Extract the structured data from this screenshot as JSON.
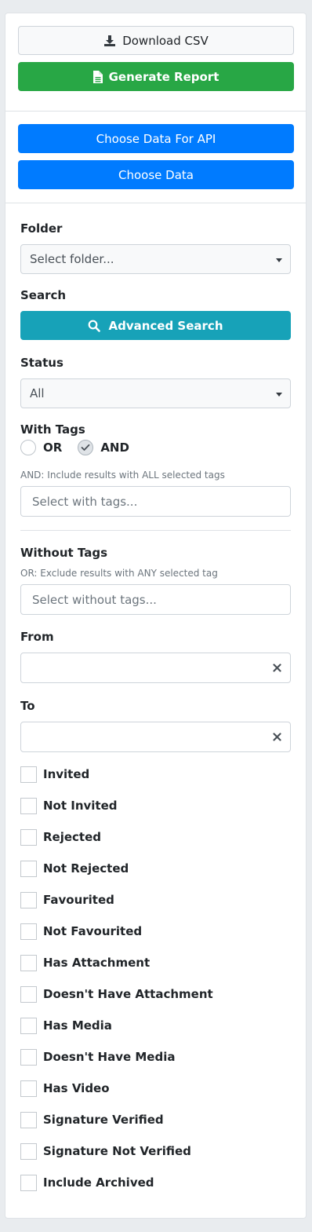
{
  "actions": {
    "download_csv": "Download CSV",
    "generate_report": "Generate Report",
    "choose_data_api": "Choose Data For API",
    "choose_data": "Choose Data"
  },
  "folder": {
    "label": "Folder",
    "value": "Select folder..."
  },
  "search": {
    "label": "Search",
    "advanced_label": "Advanced Search"
  },
  "status": {
    "label": "Status",
    "value": "All"
  },
  "with_tags": {
    "label": "With Tags",
    "mode_or": "OR",
    "mode_and": "AND",
    "selected_mode": "AND",
    "help": "AND: Include results with ALL selected tags",
    "placeholder": "Select with tags..."
  },
  "without_tags": {
    "label": "Without Tags",
    "help": "OR: Exclude results with ANY selected tag",
    "placeholder": "Select without tags..."
  },
  "dates": {
    "from_label": "From",
    "from_value": "",
    "to_label": "To",
    "to_value": ""
  },
  "filters": [
    {
      "label": "Invited",
      "checked": false
    },
    {
      "label": "Not Invited",
      "checked": false
    },
    {
      "label": "Rejected",
      "checked": false
    },
    {
      "label": "Not Rejected",
      "checked": false
    },
    {
      "label": "Favourited",
      "checked": false
    },
    {
      "label": "Not Favourited",
      "checked": false
    },
    {
      "label": "Has Attachment",
      "checked": false
    },
    {
      "label": "Doesn't Have Attachment",
      "checked": false
    },
    {
      "label": "Has Media",
      "checked": false
    },
    {
      "label": "Doesn't Have Media",
      "checked": false
    },
    {
      "label": "Has Video",
      "checked": false
    },
    {
      "label": "Signature Verified",
      "checked": false
    },
    {
      "label": "Signature Not Verified",
      "checked": false
    },
    {
      "label": "Include Archived",
      "checked": false
    }
  ],
  "colors": {
    "success": "#28a745",
    "primary": "#007bff",
    "info": "#17a2b8"
  }
}
